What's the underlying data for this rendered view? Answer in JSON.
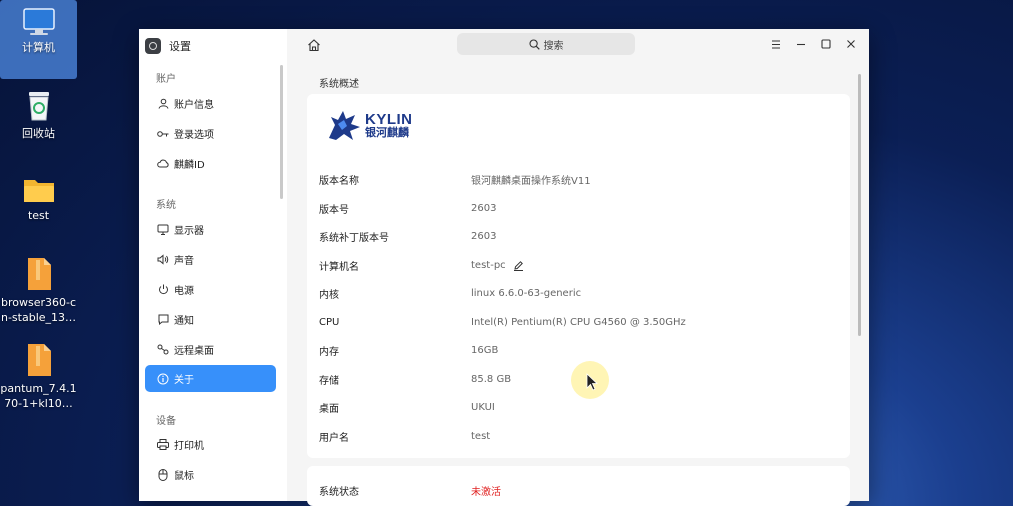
{
  "desktop": {
    "icons": [
      {
        "label": "计算机",
        "icon": "computer-icon"
      },
      {
        "label": "回收站",
        "icon": "trash-icon"
      },
      {
        "label": "test",
        "icon": "folder-icon"
      },
      {
        "label_line1": "browser360-c",
        "label_line2": "n-stable_13…",
        "icon": "package-icon"
      },
      {
        "label_line1": "pantum_7.4.1",
        "label_line2": "70-1+kl10…",
        "icon": "package-icon"
      }
    ]
  },
  "window": {
    "title": "设置",
    "search_placeholder": "搜索",
    "sidebar": {
      "sections": [
        {
          "title": "账户",
          "items": [
            {
              "label": "账户信息",
              "icon": "user-icon"
            },
            {
              "label": "登录选项",
              "icon": "key-icon"
            },
            {
              "label": "麒麟ID",
              "icon": "cloud-icon"
            }
          ]
        },
        {
          "title": "系统",
          "items": [
            {
              "label": "显示器",
              "icon": "monitor-icon"
            },
            {
              "label": "声音",
              "icon": "speaker-icon"
            },
            {
              "label": "电源",
              "icon": "power-icon"
            },
            {
              "label": "通知",
              "icon": "notification-icon"
            },
            {
              "label": "远程桌面",
              "icon": "remote-desktop-icon"
            },
            {
              "label": "关于",
              "icon": "info-icon",
              "active": true
            }
          ]
        },
        {
          "title": "设备",
          "items": [
            {
              "label": "打印机",
              "icon": "printer-icon"
            },
            {
              "label": "鼠标",
              "icon": "mouse-icon"
            }
          ]
        }
      ]
    },
    "page_title": "系统概述",
    "logo": {
      "en": "KYLIN",
      "cn": "银河麒麟"
    },
    "info_rows": [
      {
        "key": "版本名称",
        "value": "银河麒麟桌面操作系统V11"
      },
      {
        "key": "版本号",
        "value": "2603"
      },
      {
        "key": "系统补丁版本号",
        "value": "2603"
      },
      {
        "key": "计算机名",
        "value": "test-pc",
        "editable": true
      },
      {
        "key": "内核",
        "value": "linux 6.6.0-63-generic"
      },
      {
        "key": "CPU",
        "value": "Intel(R) Pentium(R) CPU G4560 @ 3.50GHz"
      },
      {
        "key": "内存",
        "value": "16GB"
      },
      {
        "key": "存储",
        "value": "85.8 GB"
      },
      {
        "key": "桌面",
        "value": "UKUI"
      },
      {
        "key": "用户名",
        "value": "test"
      }
    ],
    "status": {
      "key": "系统状态",
      "value": "未激活"
    },
    "colors": {
      "accent": "#3790fa",
      "warning": "#e02020",
      "brand": "#1e3a8a"
    }
  }
}
